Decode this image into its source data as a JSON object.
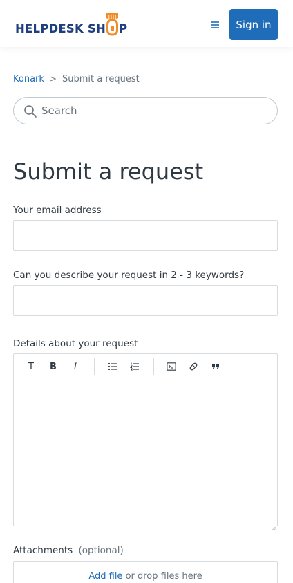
{
  "header": {
    "logo_left": "HELPDESK SH",
    "logo_right": "P",
    "signin_label": "Sign in",
    "brand_color": "#1f3e7c",
    "accent_color": "#f28c28",
    "button_color": "#1f6db8"
  },
  "breadcrumb": {
    "home": "Konark",
    "separator": ">",
    "current": "Submit a request"
  },
  "search": {
    "placeholder": "Search"
  },
  "page": {
    "title": "Submit a request"
  },
  "form": {
    "email_label": "Your email address",
    "email_value": "",
    "keywords_label": "Can you describe your request in 2 - 3 keywords?",
    "keywords_value": "",
    "details_label": "Details about your request",
    "attachments_label": "Attachments",
    "attachments_optional": "(optional)",
    "add_file": "Add file",
    "drop_text": " or drop files here"
  },
  "toolbar": {
    "text_glyph": "T",
    "bold_glyph": "B",
    "italic_glyph": "I",
    "icons": [
      "text-style-icon",
      "bold-icon",
      "italic-icon",
      "bulleted-list-icon",
      "numbered-list-icon",
      "code-block-icon",
      "link-icon",
      "quote-icon"
    ]
  }
}
